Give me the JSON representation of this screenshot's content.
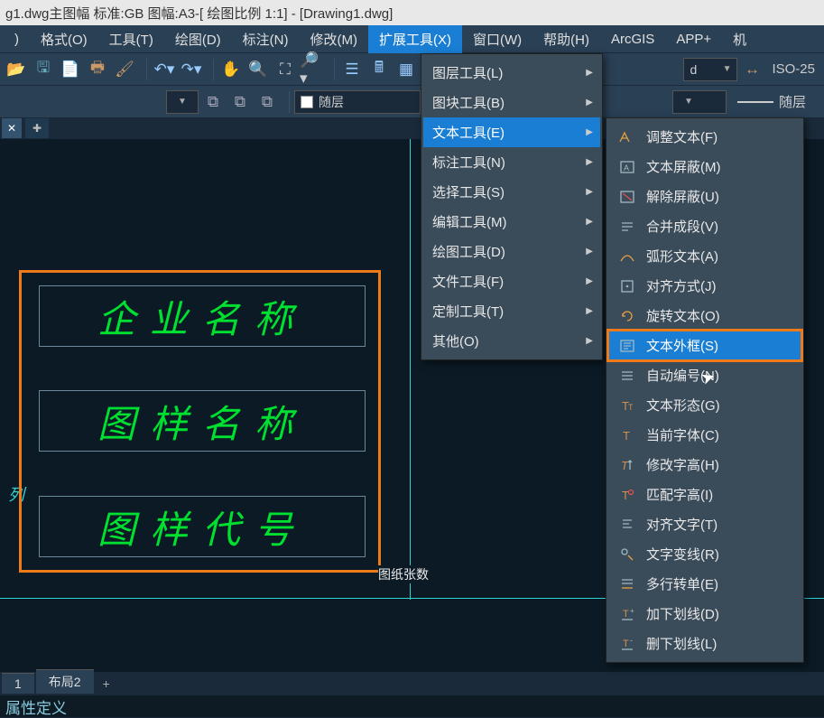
{
  "title": "g1.dwg主图幅  标准:GB 图幅:A3-[ 绘图比例 1:1] - [Drawing1.dwg]",
  "menubar": {
    "items": [
      {
        "label": ")"
      },
      {
        "label": "格式(O)"
      },
      {
        "label": "工具(T)"
      },
      {
        "label": "绘图(D)"
      },
      {
        "label": "标注(N)"
      },
      {
        "label": "修改(M)"
      },
      {
        "label": "扩展工具(X)",
        "active": true
      },
      {
        "label": "窗口(W)"
      },
      {
        "label": "帮助(H)"
      },
      {
        "label": "ArcGIS"
      },
      {
        "label": "APP+"
      },
      {
        "label": "机"
      }
    ]
  },
  "toolbar1": {
    "dim_style": "ISO-25",
    "dd_blank": "d"
  },
  "toolbar2": {
    "layer_color_label": "随层",
    "line_label": "随层"
  },
  "canvas": {
    "rows": [
      "企业名称",
      "图样名称",
      "图样代号"
    ],
    "sheet_count_label": "图纸张数",
    "tick": "列"
  },
  "bottom_tabs": {
    "model": "1",
    "layout": "布局2"
  },
  "cmdline": "属性定义",
  "panel1": {
    "items": [
      "图层工具(L)",
      "图块工具(B)",
      "文本工具(E)",
      "标注工具(N)",
      "选择工具(S)",
      "编辑工具(M)",
      "绘图工具(D)",
      "文件工具(F)",
      "定制工具(T)",
      "其他(O)"
    ]
  },
  "panel2": {
    "items": [
      "调整文本(F)",
      "文本屏蔽(M)",
      "解除屏蔽(U)",
      "合并成段(V)",
      "弧形文本(A)",
      "对齐方式(J)",
      "旋转文本(O)",
      "文本外框(S)",
      "自动编号(N)",
      "文本形态(G)",
      "当前字体(C)",
      "修改字高(H)",
      "匹配字高(I)",
      "对齐文字(T)",
      "文字变线(R)",
      "多行转单(E)",
      "加下划线(D)",
      "删下划线(L)"
    ]
  }
}
